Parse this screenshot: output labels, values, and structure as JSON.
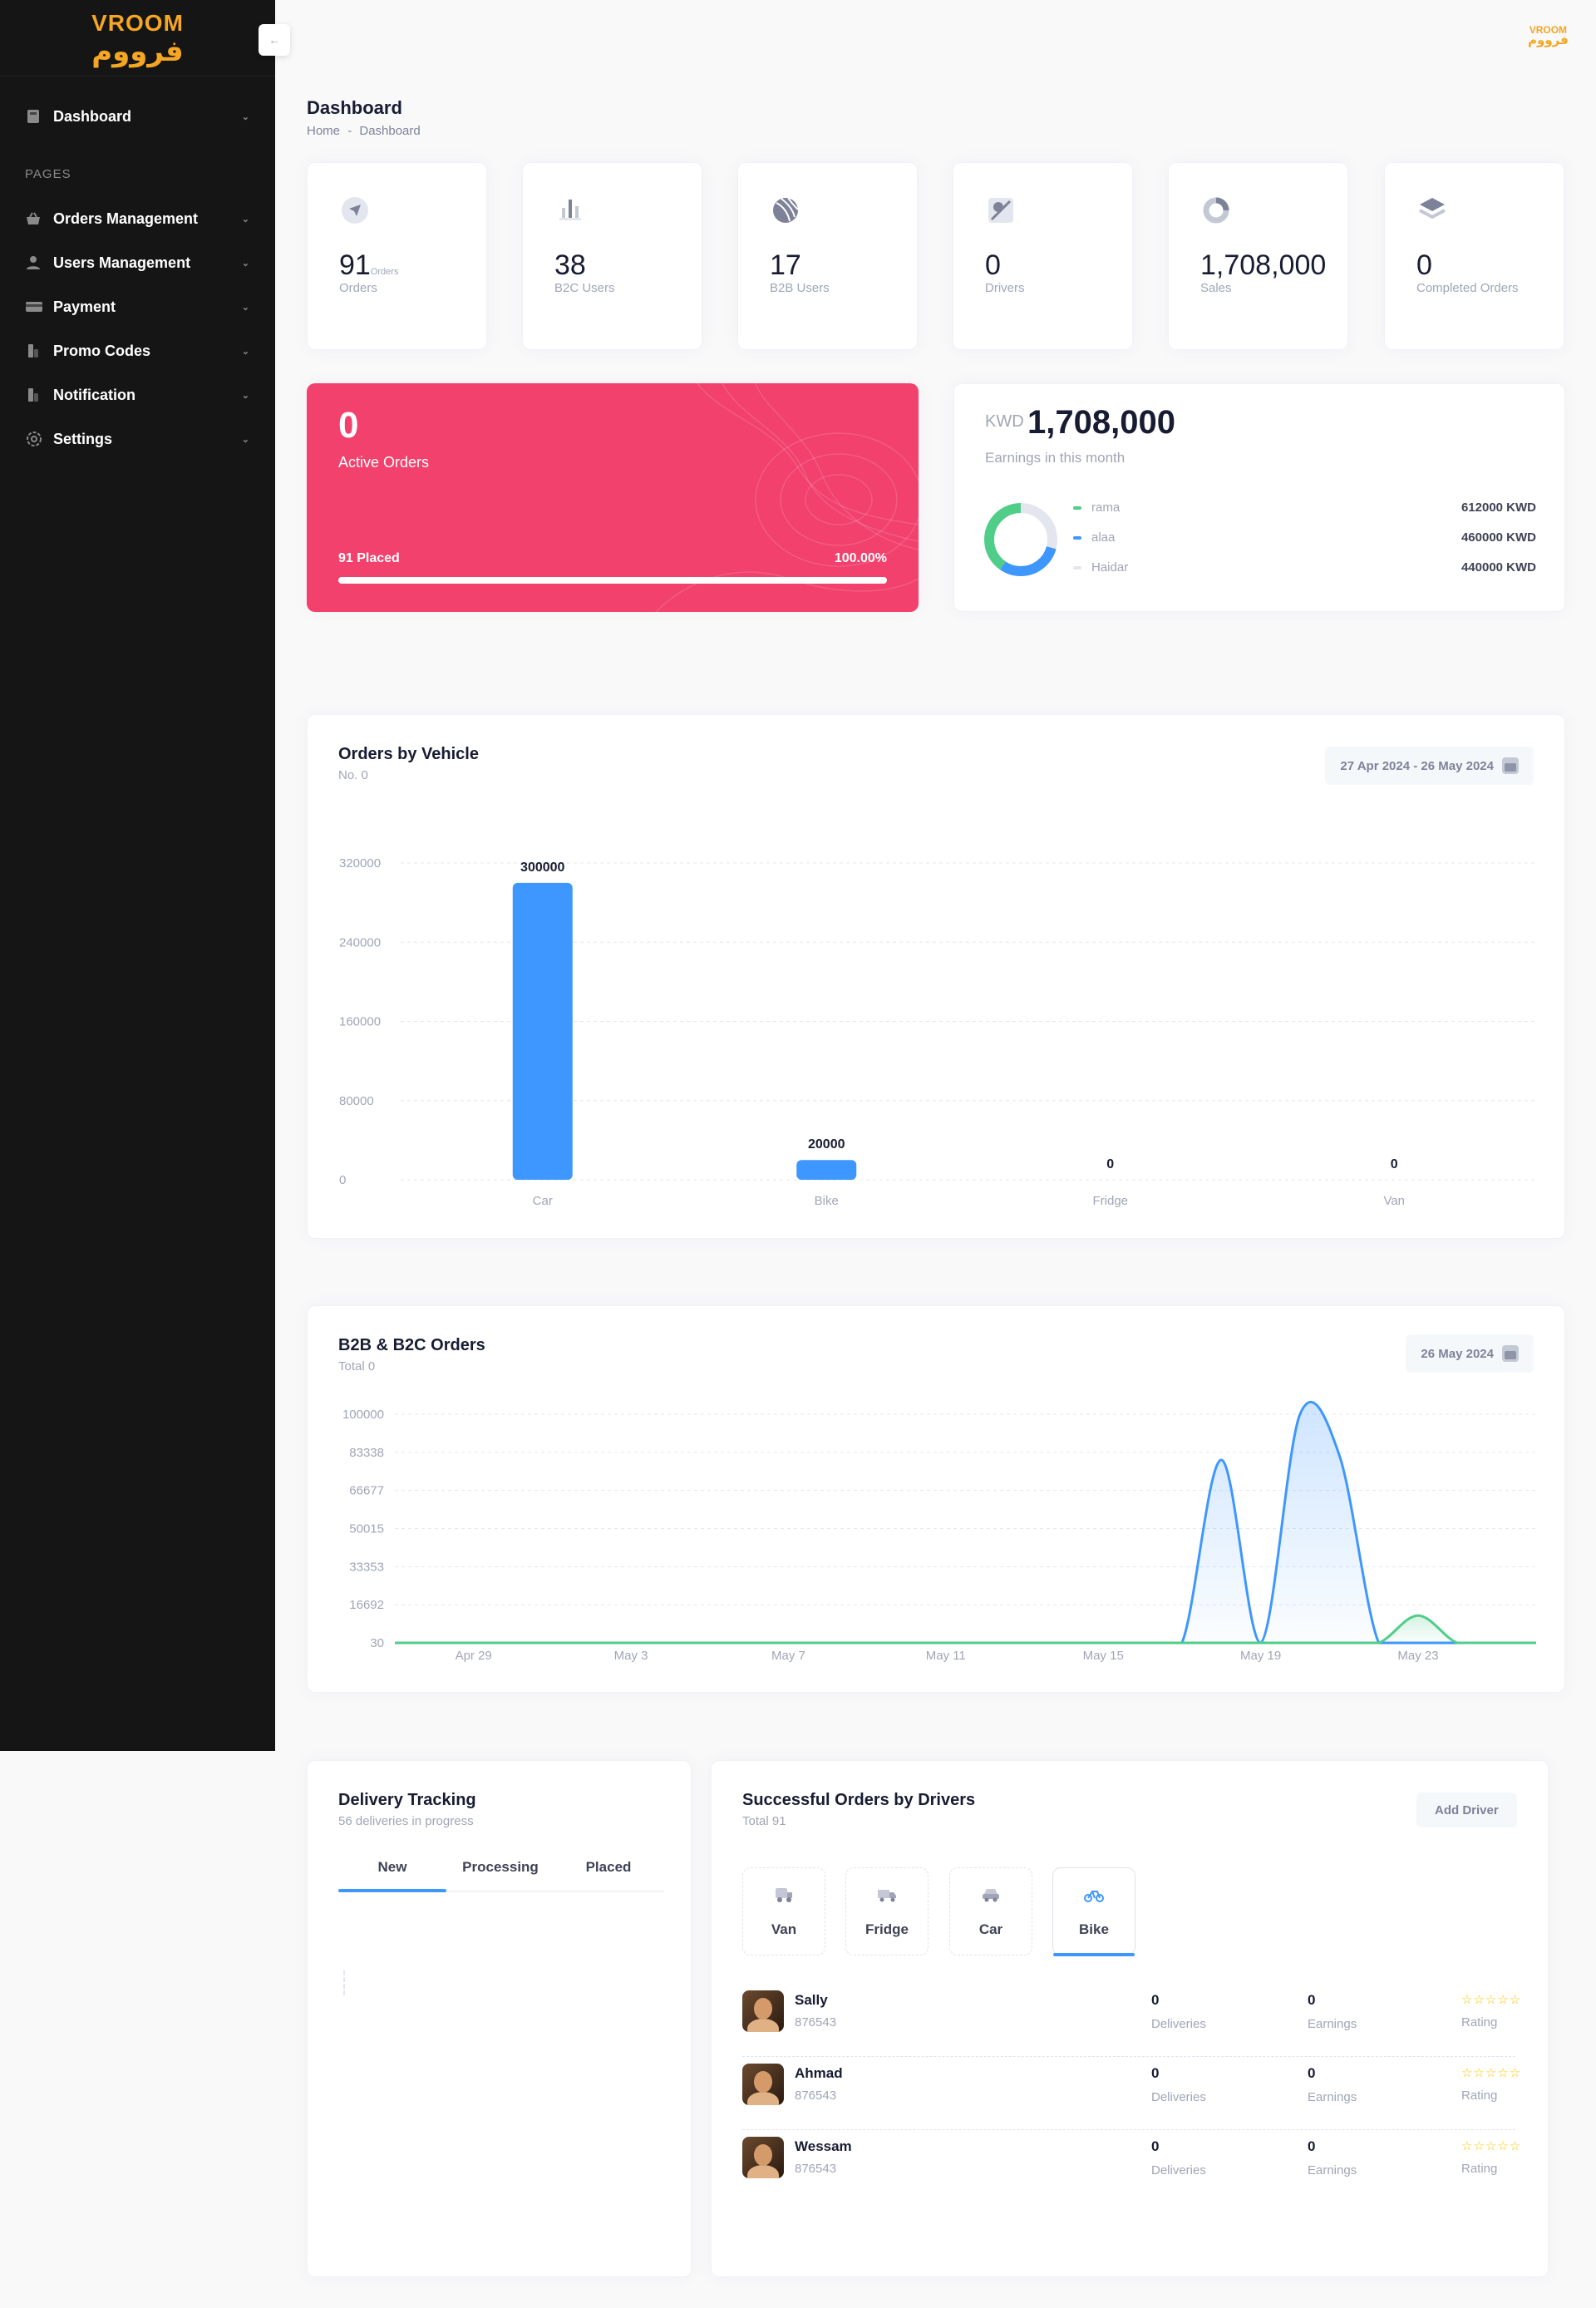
{
  "brand": {
    "name_en": "VROOM",
    "name_ar": "فرووم",
    "accent": "#f5a623"
  },
  "sidebar": {
    "section_label": "PAGES",
    "items": [
      {
        "label": "Dashboard",
        "icon": "dashboard-icon"
      },
      {
        "label": "Orders Management",
        "icon": "basket-icon"
      },
      {
        "label": "Users Management",
        "icon": "user-icon"
      },
      {
        "label": "Payment",
        "icon": "credit-card-icon"
      },
      {
        "label": "Promo Codes",
        "icon": "promo-icon"
      },
      {
        "label": "Notification",
        "icon": "notification-icon"
      },
      {
        "label": "Settings",
        "icon": "gear-icon"
      }
    ]
  },
  "header": {
    "title": "Dashboard",
    "breadcrumb": [
      "Home",
      "Dashboard"
    ]
  },
  "stats": [
    {
      "value": "91",
      "unit": "Orders",
      "label": "Orders",
      "icon": "navigation-icon"
    },
    {
      "value": "38",
      "unit": "",
      "label": "B2C Users",
      "icon": "bar-chart-icon"
    },
    {
      "value": "17",
      "unit": "",
      "label": "B2B Users",
      "icon": "basketball-icon"
    },
    {
      "value": "0",
      "unit": "",
      "label": "Drivers",
      "icon": "map-pin-icon"
    },
    {
      "value": "1,708,000",
      "unit": "",
      "label": "Sales",
      "icon": "ring-icon"
    },
    {
      "value": "0",
      "unit": "",
      "label": "Completed Orders",
      "icon": "layers-icon"
    }
  ],
  "active_orders": {
    "value": "0",
    "label": "Active Orders",
    "placed": "91 Placed",
    "percent_label": "100.00%",
    "progress": 1.0,
    "color": "#f1416c"
  },
  "earnings": {
    "currency": "KWD",
    "value": "1,708,000",
    "label": "Earnings in this month",
    "breakdown": [
      {
        "name": "rama",
        "amount": "612000 KWD",
        "color": "#50cd89"
      },
      {
        "name": "alaa",
        "amount": "460000 KWD",
        "color": "#3e97ff"
      },
      {
        "name": "Haidar",
        "amount": "440000 KWD",
        "color": "#e4e6ef"
      }
    ]
  },
  "orders_by_vehicle": {
    "title": "Orders by Vehicle",
    "subtitle": "No. 0",
    "date_range": "27 Apr 2024 - 26 May 2024",
    "chart_data": {
      "type": "bar",
      "categories": [
        "Car",
        "Bike",
        "Fridge",
        "Van"
      ],
      "values": [
        300000,
        20000,
        0,
        0
      ],
      "ylim": [
        0,
        320000
      ],
      "yticks": [
        0,
        80000,
        160000,
        240000,
        320000
      ],
      "grid": true,
      "color": "#3e97ff"
    }
  },
  "b2b_b2c": {
    "title": "B2B & B2C Orders",
    "subtitle": "Total 0",
    "date": "26 May 2024",
    "chart_data": {
      "type": "area",
      "x": [
        "Apr 27",
        "Apr 28",
        "Apr 29",
        "Apr 30",
        "May 1",
        "May 2",
        "May 3",
        "May 4",
        "May 5",
        "May 6",
        "May 7",
        "May 8",
        "May 9",
        "May 10",
        "May 11",
        "May 12",
        "May 13",
        "May 14",
        "May 15",
        "May 16",
        "May 17",
        "May 18",
        "May 19",
        "May 20",
        "May 21",
        "May 22",
        "May 23",
        "May 24",
        "May 25",
        "May 26"
      ],
      "xticks": [
        "Apr 29",
        "May 3",
        "May 7",
        "May 11",
        "May 15",
        "May 19",
        "May 23"
      ],
      "yticks": [
        30,
        16692,
        33353,
        50015,
        66677,
        83338,
        100000
      ],
      "ylim": [
        30,
        100000
      ],
      "grid": true,
      "series": [
        {
          "values": [
            30,
            30,
            30,
            30,
            30,
            30,
            30,
            30,
            30,
            30,
            30,
            30,
            30,
            30,
            30,
            30,
            30,
            30,
            30,
            30,
            30,
            80000,
            30,
            100000,
            82000,
            30,
            30,
            30,
            30,
            30
          ],
          "color": "#3e97ff"
        },
        {
          "values": [
            30,
            30,
            30,
            30,
            30,
            30,
            30,
            30,
            30,
            30,
            30,
            30,
            30,
            30,
            30,
            30,
            30,
            30,
            30,
            30,
            30,
            30,
            30,
            30,
            30,
            30,
            12000,
            30,
            30,
            30
          ],
          "color": "#50cd89"
        }
      ]
    }
  },
  "delivery_tracking": {
    "title": "Delivery Tracking",
    "subtitle": "56 deliveries in progress",
    "tabs": [
      "New",
      "Processing",
      "Placed"
    ]
  },
  "drivers": {
    "title": "Successful Orders by Drivers",
    "subtitle": "Total 91",
    "add_button": "Add Driver",
    "vehicle_tabs": [
      {
        "label": "Van",
        "icon": "van-icon"
      },
      {
        "label": "Fridge",
        "icon": "truck-icon"
      },
      {
        "label": "Car",
        "icon": "car-icon"
      },
      {
        "label": "Bike",
        "icon": "bike-icon"
      }
    ],
    "columns": {
      "deliveries": "Deliveries",
      "earnings": "Earnings",
      "rating": "Rating"
    },
    "rows": [
      {
        "name": "Sally",
        "id": "876543",
        "deliveries": "0",
        "earnings": "0",
        "rating": 0
      },
      {
        "name": "Ahmad",
        "id": "876543",
        "deliveries": "0",
        "earnings": "0",
        "rating": 0
      },
      {
        "name": "Wessam",
        "id": "876543",
        "deliveries": "0",
        "earnings": "0",
        "rating": 0
      }
    ]
  }
}
